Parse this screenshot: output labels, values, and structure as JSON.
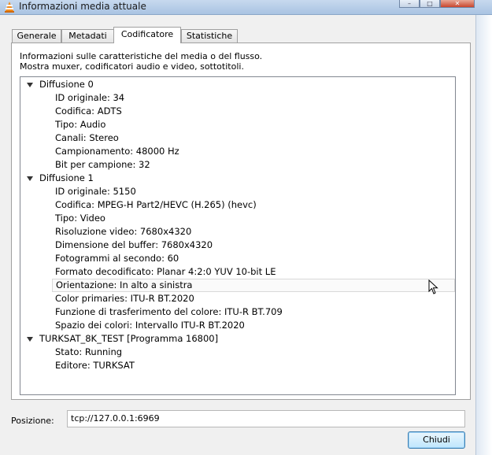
{
  "window": {
    "title": "Informazioni media attuale",
    "buttons": {
      "minimize": "–",
      "maximize": "□",
      "close": "✕"
    }
  },
  "tabs": [
    {
      "label": "Generale"
    },
    {
      "label": "Metadati"
    },
    {
      "label": "Codificatore"
    },
    {
      "label": "Statistiche"
    }
  ],
  "description": {
    "line1": "Informazioni sulle caratteristiche del media o del flusso.",
    "line2": "Mostra muxer, codificatori audio e video, sottotitoli."
  },
  "tree": [
    {
      "label": "Diffusione 0",
      "children": [
        "ID originale: 34",
        "Codifica: ADTS",
        "Tipo: Audio",
        "Canali: Stereo",
        "Campionamento: 48000 Hz",
        "Bit per campione: 32"
      ]
    },
    {
      "label": "Diffusione 1",
      "children": [
        "ID originale: 5150",
        "Codifica: MPEG-H Part2/HEVC (H.265) (hevc)",
        "Tipo: Video",
        "Risoluzione video: 7680x4320",
        "Dimensione del buffer: 7680x4320",
        "Fotogrammi al secondo: 60",
        "Formato decodificato: Planar 4:2:0 YUV 10-bit LE",
        "Orientazione: In alto a sinistra",
        "Color primaries: ITU-R BT.2020",
        "Funzione di trasferimento del colore: ITU-R BT.709",
        "Spazio dei colori: Intervallo ITU-R BT.2020"
      ]
    },
    {
      "label": "TURKSAT_8K_TEST [Programma 16800]",
      "children": [
        "Stato: Running",
        "Editore: TURKSAT"
      ]
    }
  ],
  "position": {
    "label": "Posizione:",
    "value": "tcp://127.0.0.1:6969"
  },
  "close_button": "Chiudi",
  "icons": {
    "app": "vlc-cone-icon",
    "cursor": "mouse-pointer-icon"
  },
  "colors": {
    "accent": "#3c7fb1",
    "titlebar": "#a9c3e2"
  }
}
